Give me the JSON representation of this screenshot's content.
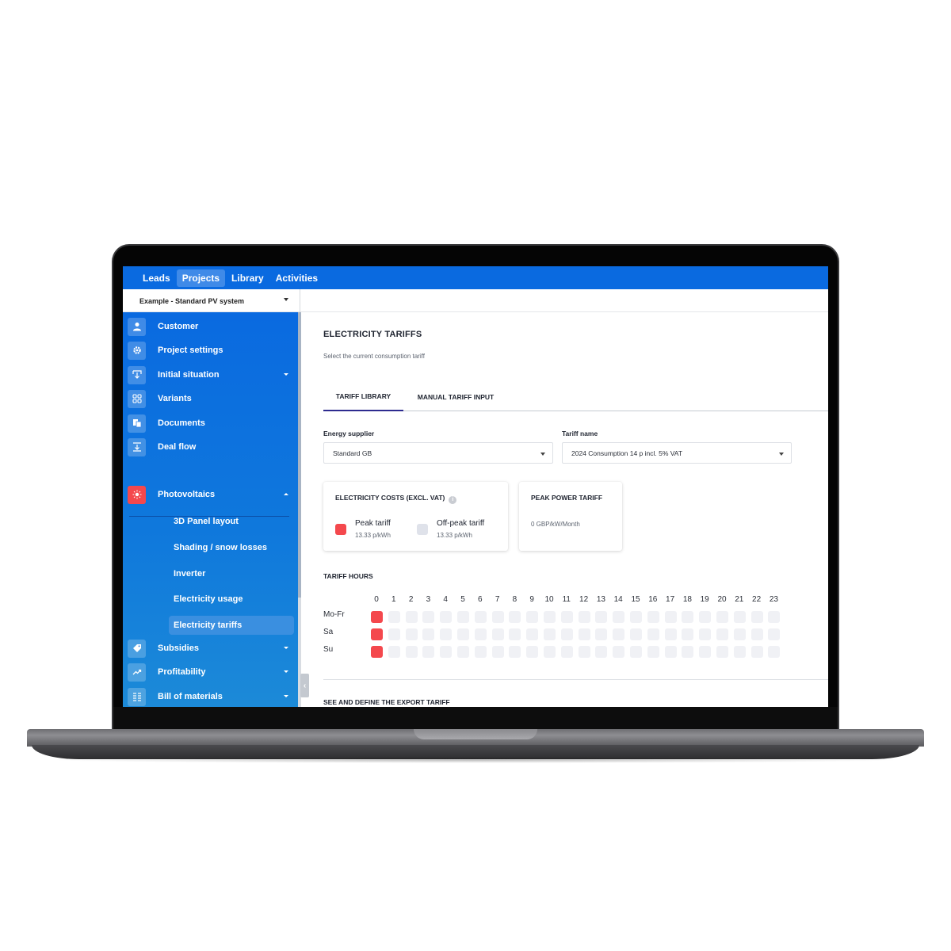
{
  "topnav": {
    "items": [
      {
        "label": "Leads",
        "active": false
      },
      {
        "label": "Projects",
        "active": true
      },
      {
        "label": "Library",
        "active": false
      },
      {
        "label": "Activities",
        "active": false
      }
    ]
  },
  "project_selector": {
    "value": "Example - Standard PV system"
  },
  "sidebar": {
    "items": [
      {
        "label": "Customer",
        "icon": "person-icon",
        "glyph": "👤",
        "caret": ""
      },
      {
        "label": "Project settings",
        "icon": "gear-icon",
        "glyph": "⚙",
        "caret": ""
      },
      {
        "label": "Initial situation",
        "icon": "download-tray-icon",
        "glyph": "⤓",
        "caret": "down"
      },
      {
        "label": "Variants",
        "icon": "grid-icon",
        "glyph": "▦",
        "caret": ""
      },
      {
        "label": "Documents",
        "icon": "documents-icon",
        "glyph": "▤",
        "caret": ""
      },
      {
        "label": "Deal flow",
        "icon": "deal-flow-icon",
        "glyph": "⤓",
        "caret": ""
      }
    ],
    "photovoltaics": {
      "label": "Photovoltaics",
      "icon": "sun-icon",
      "glyph": "☀",
      "expanded": true
    },
    "sub_items": [
      {
        "label": "3D Panel layout",
        "active": false
      },
      {
        "label": "Shading / snow losses",
        "active": false
      },
      {
        "label": "Inverter",
        "active": false
      },
      {
        "label": "Electricity usage",
        "active": false
      },
      {
        "label": "Electricity tariffs",
        "active": true
      }
    ],
    "bottom_items": [
      {
        "label": "Subsidies",
        "icon": "tag-icon",
        "glyph": "🏷",
        "caret": "down"
      },
      {
        "label": "Profitability",
        "icon": "trend-up-icon",
        "glyph": "↗",
        "caret": "down"
      },
      {
        "label": "Bill of materials",
        "icon": "list-icon",
        "glyph": "☰",
        "caret": "down"
      }
    ],
    "collapse_glyph": "‹"
  },
  "main": {
    "title": "ELECTRICITY TARIFFS",
    "subtitle": "Select the current consumption tariff",
    "tabs": [
      {
        "label": "TARIFF LIBRARY",
        "active": true
      },
      {
        "label": "MANUAL TARIFF INPUT",
        "active": false
      }
    ],
    "energy_supplier": {
      "label": "Energy supplier",
      "value": "Standard GB"
    },
    "tariff_name": {
      "label": "Tariff name",
      "value": "2024 Consumption 14 p incl. 5% VAT"
    },
    "costs_card": {
      "title": "ELECTRICITY COSTS (EXCL. VAT)",
      "info_glyph": "i",
      "legend": [
        {
          "name": "Peak tariff",
          "value": "13.33 p/kWh",
          "color": "#f4484d"
        },
        {
          "name": "Off-peak tariff",
          "value": "13.33 p/kWh",
          "color": "#dfe2ea"
        }
      ]
    },
    "peak_power_card": {
      "title": "PEAK POWER TARIFF",
      "value": "0 GBP/kW/Month"
    },
    "tariff_hours": {
      "title": "TARIFF HOURS",
      "hours": [
        "0",
        "1",
        "2",
        "3",
        "4",
        "5",
        "6",
        "7",
        "8",
        "9",
        "10",
        "11",
        "12",
        "13",
        "14",
        "15",
        "16",
        "17",
        "18",
        "19",
        "20",
        "21",
        "22",
        "23"
      ],
      "rows": [
        {
          "day": "Mo-Fr",
          "peak_hours": [
            0
          ]
        },
        {
          "day": "Sa",
          "peak_hours": [
            0
          ]
        },
        {
          "day": "Su",
          "peak_hours": [
            0
          ]
        }
      ]
    },
    "export_title": "SEE AND DEFINE THE EXPORT TARIFF"
  },
  "colors": {
    "brand_blue": "#0a6ae0",
    "peak_red": "#f4484d",
    "offpeak_gray": "#f0f1f5",
    "tab_underline": "#2d2b8f"
  }
}
